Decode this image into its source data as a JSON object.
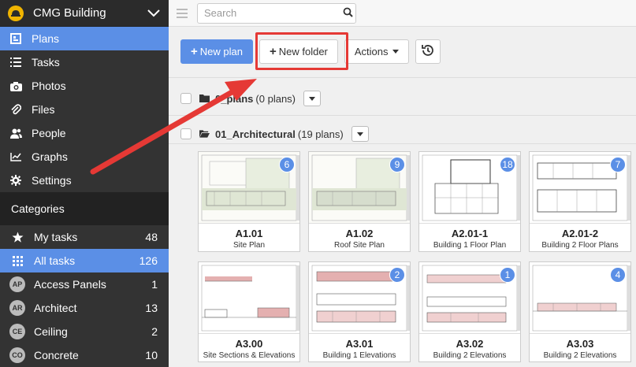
{
  "app": {
    "project_name": "CMG Building"
  },
  "nav": [
    {
      "label": "Plans",
      "icon": "plans-icon",
      "active": true
    },
    {
      "label": "Tasks",
      "icon": "tasks-icon",
      "active": false
    },
    {
      "label": "Photos",
      "icon": "camera-icon",
      "active": false
    },
    {
      "label": "Files",
      "icon": "paperclip-icon",
      "active": false
    },
    {
      "label": "People",
      "icon": "people-icon",
      "active": false
    },
    {
      "label": "Graphs",
      "icon": "graph-icon",
      "active": false
    },
    {
      "label": "Settings",
      "icon": "gear-icon",
      "active": false
    }
  ],
  "categories": {
    "header": "Categories",
    "items": [
      {
        "label": "My tasks",
        "count": "48",
        "icon": "star-icon"
      },
      {
        "label": "All tasks",
        "count": "126",
        "icon": "grid-icon",
        "active": true
      },
      {
        "label": "Access Panels",
        "count": "1",
        "badge": "AP"
      },
      {
        "label": "Architect",
        "count": "13",
        "badge": "AR"
      },
      {
        "label": "Ceiling",
        "count": "2",
        "badge": "CE"
      },
      {
        "label": "Concrete",
        "count": "10",
        "badge": "CO"
      }
    ]
  },
  "search": {
    "placeholder": "Search"
  },
  "toolbar": {
    "new_plan": "New plan",
    "new_folder": "New folder",
    "actions": "Actions"
  },
  "folders": [
    {
      "name": "0_plans",
      "count": "(0 plans)"
    },
    {
      "name": "01_Architectural",
      "count": "(19 plans)"
    }
  ],
  "plans": [
    {
      "code": "A1.01",
      "name": "Site Plan",
      "tasks": "6"
    },
    {
      "code": "A1.02",
      "name": "Roof Site Plan",
      "tasks": "9"
    },
    {
      "code": "A2.01-1",
      "name": "Building 1 Floor Plan",
      "tasks": "18"
    },
    {
      "code": "A2.01-2",
      "name": "Building 2 Floor Plans",
      "tasks": "7"
    },
    {
      "code": "A3.00",
      "name": "Site Sections & Elevations",
      "tasks": ""
    },
    {
      "code": "A3.01",
      "name": "Building 1 Elevations",
      "tasks": "2"
    },
    {
      "code": "A3.02",
      "name": "Building 2 Elevations",
      "tasks": "1"
    },
    {
      "code": "A3.03",
      "name": "Building 2 Elevations",
      "tasks": "4"
    }
  ],
  "colors": {
    "accent": "#5b8fe6",
    "sidebar": "#2b2b2b",
    "highlight": "#e53935"
  }
}
